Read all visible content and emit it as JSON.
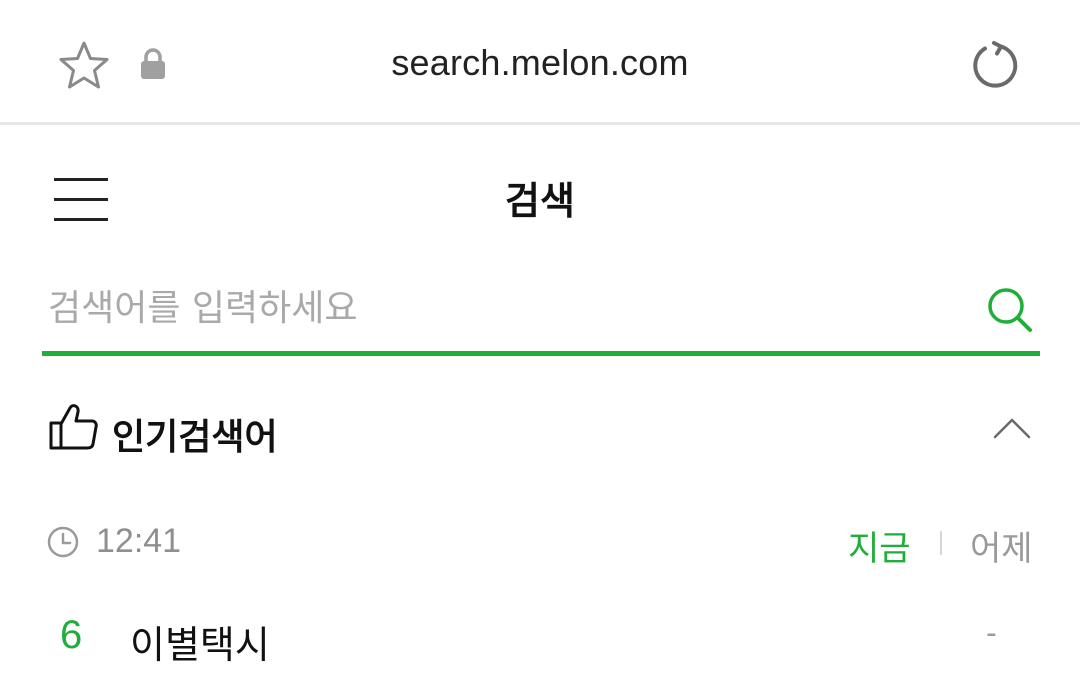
{
  "browser": {
    "url": "search.melon.com",
    "icons": {
      "favorite": "star-icon",
      "secure": "lock-icon",
      "reload": "reload-icon"
    }
  },
  "header": {
    "title": "검색",
    "menu_icon": "hamburger-menu-icon"
  },
  "search": {
    "placeholder": "검색어를 입력하세요",
    "value": "",
    "icon": "search-icon"
  },
  "popular": {
    "title": "인기검색어",
    "icon": "thumbs-up-icon",
    "toggle_icon": "chevron-up-icon",
    "time": "12:41",
    "time_icon": "clock-icon",
    "tabs": [
      {
        "label": "지금",
        "active": true
      },
      {
        "label": "어제",
        "active": false
      }
    ],
    "items": [
      {
        "rank": "6",
        "keyword": "이별택시",
        "change": "-"
      }
    ]
  },
  "colors": {
    "accent": "#1fae3a",
    "muted_text": "#8f8f8f",
    "placeholder": "#a9a9a9",
    "divider": "#e6e6e6"
  }
}
